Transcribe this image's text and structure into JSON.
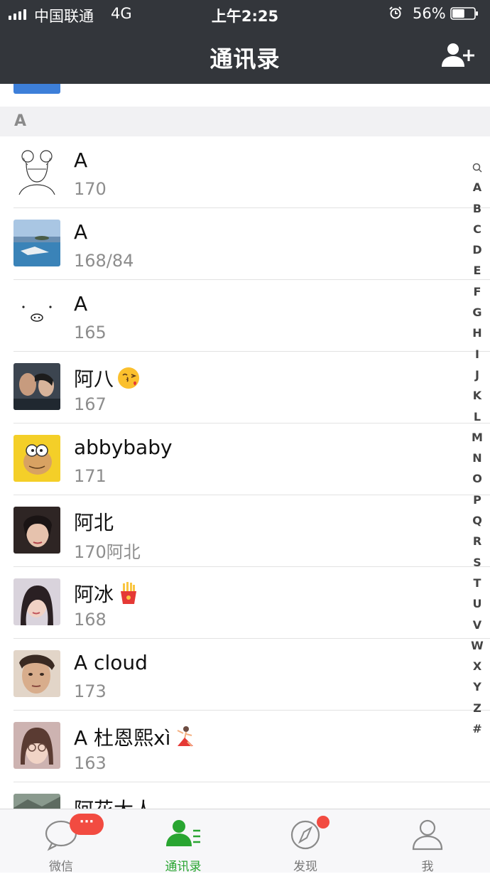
{
  "status_bar": {
    "carrier": "中国联通",
    "network": "4G",
    "time": "上午2:25",
    "battery": "56%",
    "battery_level": 0.56
  },
  "nav": {
    "title": "通讯录",
    "add_icon": "add-contact-icon"
  },
  "section": {
    "letter": "A"
  },
  "contacts": [
    {
      "name": "A",
      "sub": "170",
      "avatar": "sketch-girl"
    },
    {
      "name": "A",
      "sub": "168/84",
      "avatar": "sea-photo"
    },
    {
      "name": "A",
      "sub": "165",
      "avatar": "pig-face"
    },
    {
      "name": "阿八",
      "sub": "167",
      "avatar": "couple-photo",
      "emoji": "kiss-emoji"
    },
    {
      "name": "abbybaby",
      "sub": "171",
      "avatar": "cartoon-yellow"
    },
    {
      "name": "阿北",
      "sub": "170阿北",
      "avatar": "woman-photo"
    },
    {
      "name": "阿冰",
      "sub": "168",
      "avatar": "woman-photo-2",
      "emoji": "fries-emoji"
    },
    {
      "name": "A cloud",
      "sub": "173",
      "avatar": "selfie-photo"
    },
    {
      "name": "A 杜恩熙xì",
      "sub": "163",
      "avatar": "glasses-photo",
      "emoji": "dancer-emoji"
    },
    {
      "name": "阿花大人",
      "sub": "",
      "avatar": "partial-photo"
    }
  ],
  "index_letters": [
    "A",
    "B",
    "C",
    "D",
    "E",
    "F",
    "G",
    "H",
    "I",
    "J",
    "K",
    "L",
    "M",
    "N",
    "O",
    "P",
    "Q",
    "R",
    "S",
    "T",
    "U",
    "V",
    "W",
    "X",
    "Y",
    "Z",
    "#"
  ],
  "tabs": [
    {
      "label": "微信",
      "icon": "chat-bubble-icon",
      "badge": "···"
    },
    {
      "label": "通讯录",
      "icon": "contacts-icon"
    },
    {
      "label": "发现",
      "icon": "compass-icon"
    },
    {
      "label": "我",
      "icon": "person-icon"
    }
  ],
  "colors": {
    "navbar": "#33363b",
    "accent": "#29a531",
    "badge": "#f24b41"
  }
}
